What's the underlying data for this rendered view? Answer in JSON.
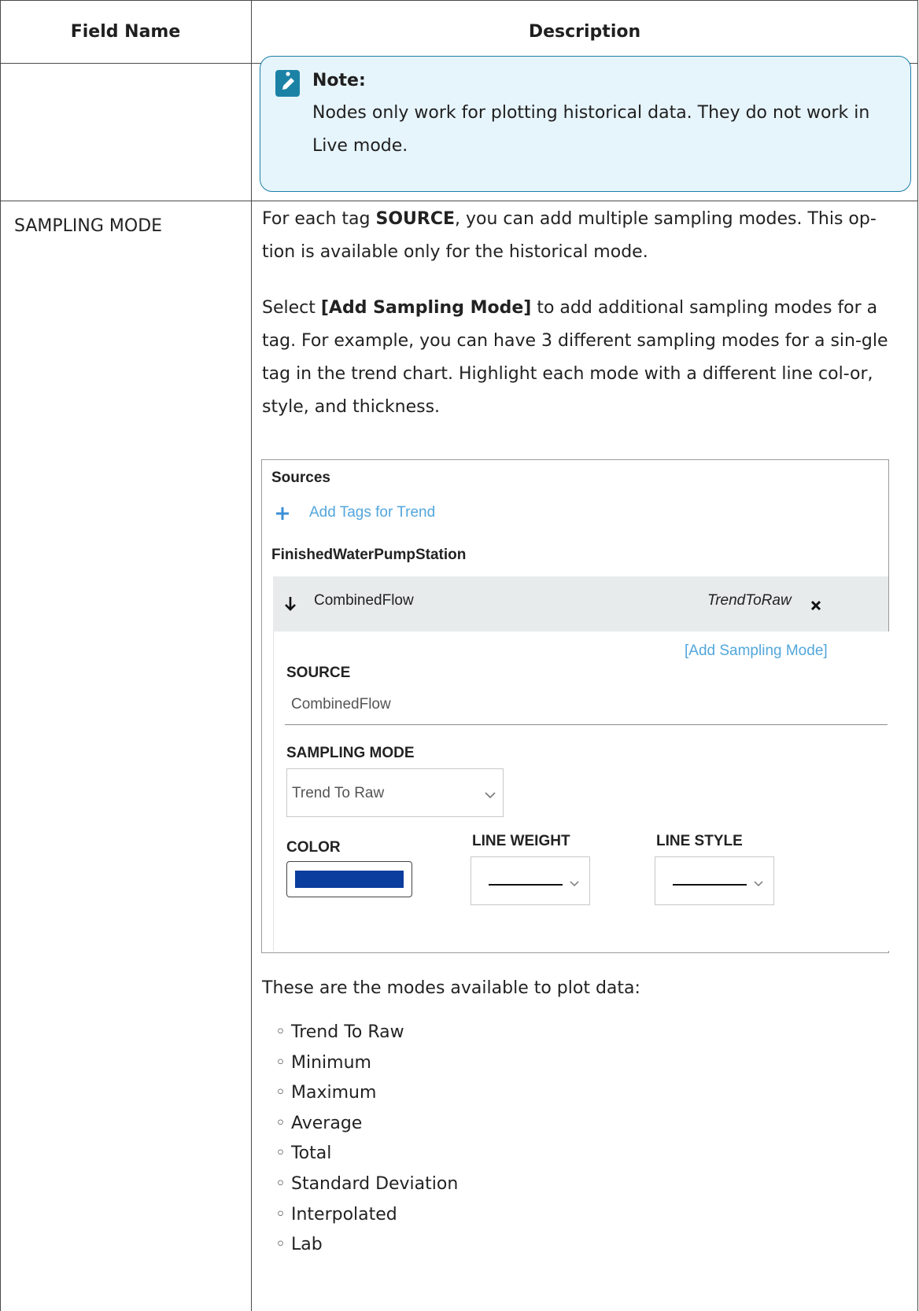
{
  "table": {
    "headers": {
      "field_name": "Field Name",
      "description": "Description"
    }
  },
  "note": {
    "icon": "edit-note-icon",
    "title": "Note:",
    "body": "Nodes only work for plotting historical data. They do not work in Live mode."
  },
  "row": {
    "field_name": "SAMPLING MODE",
    "p1_a": "For each tag ",
    "p1_b": "SOURCE",
    "p1_c": ", you can add multiple sampling modes. This op-tion is available only for the historical mode.",
    "p2_a": "Select ",
    "p2_b": "[Add Sampling Mode]",
    "p2_c": " to add additional sampling modes for a tag. For example, you can have 3 different sampling modes for a sin-gle tag in the trend chart. Highlight each mode with a different line col-or, style, and thickness.",
    "p3": "These are the modes available to plot data:",
    "modes": [
      "Trend To Raw",
      "Minimum",
      "Maximum",
      "Average",
      "Total",
      "Standard Deviation",
      "Interpolated",
      "Lab"
    ]
  },
  "shot": {
    "sources": "Sources",
    "add_tags": "Add Tags for Trend",
    "group": "FinishedWaterPumpStation",
    "tag_name": "CombinedFlow",
    "tag_mode": "TrendToRaw",
    "add_sampling": "[Add Sampling Mode]",
    "source_label": "SOURCE",
    "source_value": "CombinedFlow",
    "sampling_label": "SAMPLING MODE",
    "sampling_value": "Trend To Raw",
    "color_label": "COLOR",
    "line_weight_label": "LINE WEIGHT",
    "line_style_label": "LINE STYLE",
    "color_value": "#0a3d9e",
    "link_color": "#52a6dc"
  }
}
